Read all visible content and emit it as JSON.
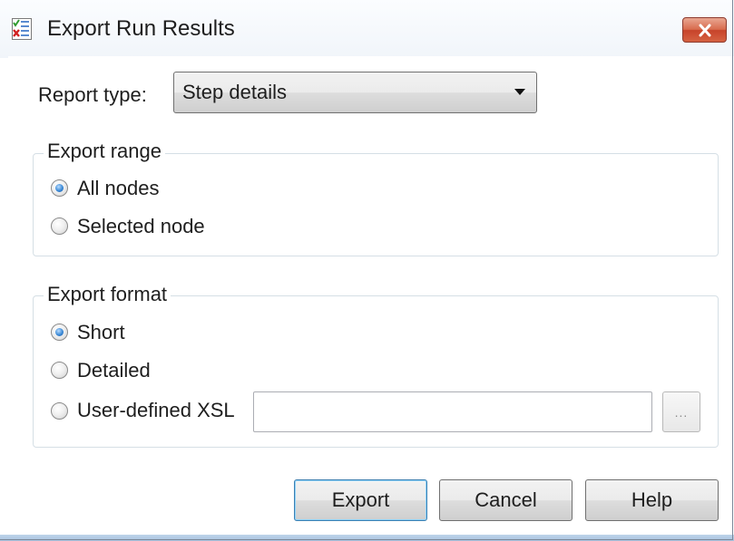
{
  "window": {
    "title": "Export Run Results",
    "app_icon": "report-icon",
    "close_icon": "close-icon"
  },
  "report_type": {
    "label": "Report type:",
    "selected": "Step details"
  },
  "export_range": {
    "legend": "Export range",
    "options": [
      {
        "label": "All nodes",
        "checked": true
      },
      {
        "label": "Selected node",
        "checked": false
      }
    ]
  },
  "export_format": {
    "legend": "Export format",
    "options": [
      {
        "label": "Short",
        "checked": true
      },
      {
        "label": "Detailed",
        "checked": false
      },
      {
        "label": "User-defined XSL",
        "checked": false
      }
    ],
    "xsl_path_value": "",
    "browse_label": "..."
  },
  "buttons": {
    "export": "Export",
    "cancel": "Cancel",
    "help": "Help"
  },
  "colors": {
    "close_button": "#d05a3c",
    "radio_checked": "#3c8ad6",
    "default_button_border": "#3c7fb1"
  }
}
